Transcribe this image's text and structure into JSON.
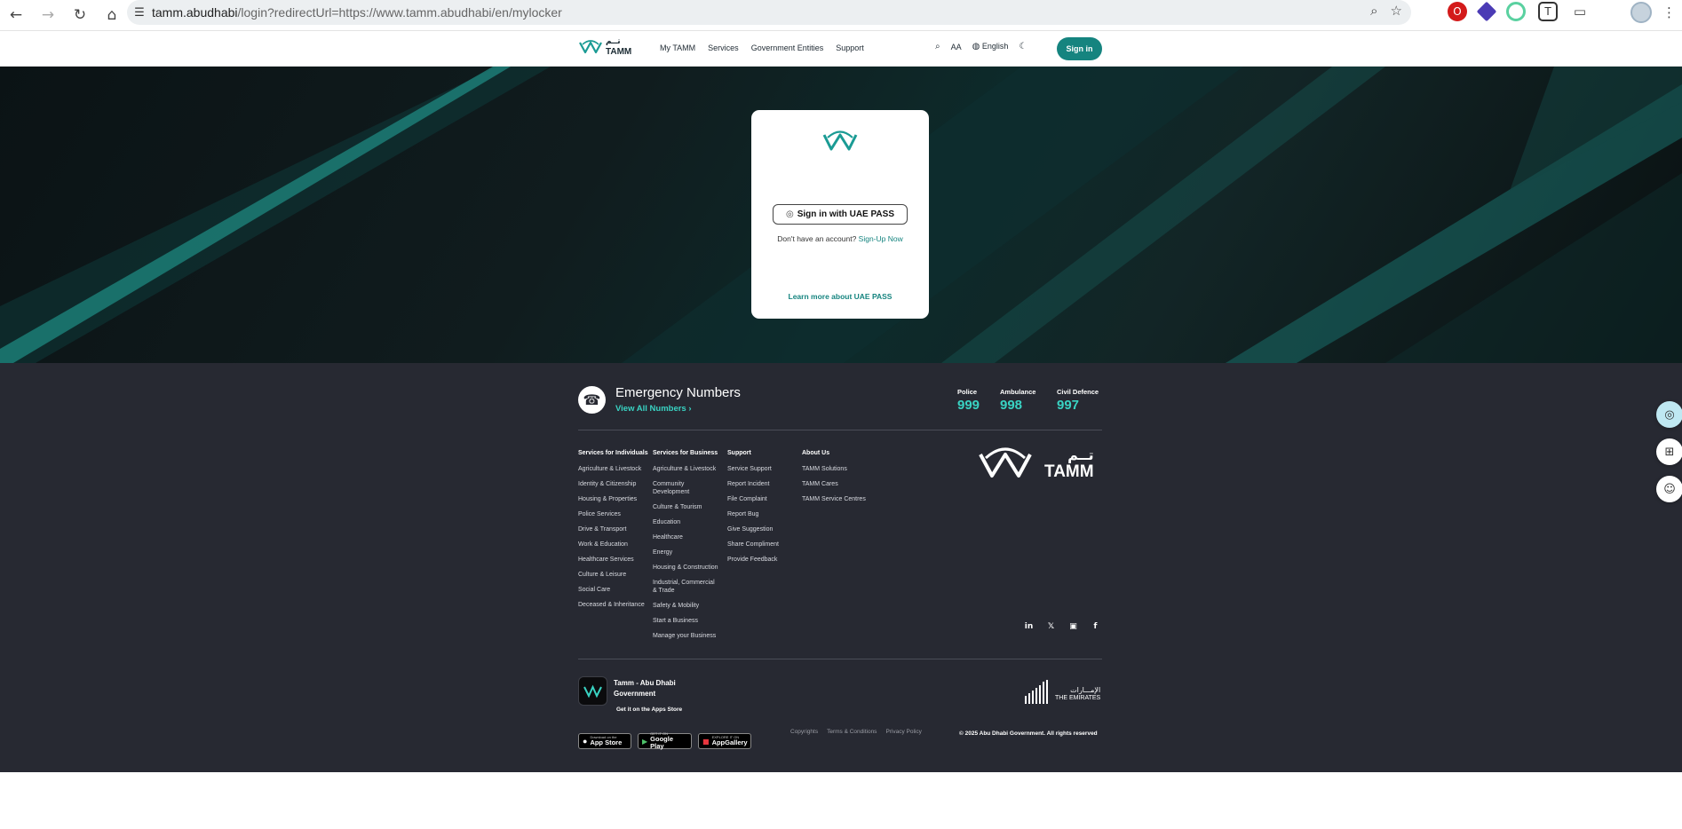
{
  "browser": {
    "back_icon": "←",
    "forward_icon": "→",
    "reload_icon": "↻",
    "home_icon": "⌂",
    "tune_icon": "☰",
    "url_host": "tamm.abudhabi",
    "url_path": "/login?redirectUrl=https://www.tamm.abudhabi/en/mylocker",
    "zoom_icon": "⌕",
    "star_icon": "☆",
    "menu_icon": "⋮"
  },
  "header": {
    "logo_arabic": "تــم",
    "logo_word": "TAMM",
    "nav": [
      "My TAMM",
      "Services",
      "Government Entities",
      "Support"
    ],
    "search_icon": "⌕",
    "text_size_label": "AA",
    "globe_icon": "◍",
    "language": "English",
    "theme_icon": "☾",
    "sign_in": "Sign in"
  },
  "login_card": {
    "uae_pass_button": "Sign in with UAE PASS",
    "fingerprint_icon": "◎",
    "no_account": "Don't have an account?",
    "sign_up": "Sign-Up Now",
    "learn_more": "Learn more about UAE PASS"
  },
  "footer": {
    "phone_icon": "☎",
    "emergency_title": "Emergency Numbers",
    "view_all": "View All Numbers  ›",
    "numbers": [
      {
        "label": "Police",
        "value": "999"
      },
      {
        "label": "Ambulance",
        "value": "998"
      },
      {
        "label": "Civil Defence",
        "value": "997"
      }
    ],
    "columns": [
      {
        "heading": "Services for Individuals",
        "items": [
          "Agriculture & Livestock",
          "Identity & Citizenship",
          "Housing & Properties",
          "Police Services",
          "Drive & Transport",
          "Work & Education",
          "Healthcare Services",
          "Culture & Leisure",
          "Social Care",
          "Deceased & Inheritance"
        ]
      },
      {
        "heading": "Services for Business",
        "items": [
          "Agriculture & Livestock",
          "Community Development",
          "Culture & Tourism",
          "Education",
          "Healthcare",
          "Energy",
          "Housing & Construction",
          "Industrial, Commercial & Trade",
          "Safety & Mobility",
          "Start a Business",
          "Manage your Business"
        ]
      },
      {
        "heading": "Support",
        "items": [
          "Service Support",
          "Report Incident",
          "File Complaint",
          "Report Bug",
          "Give Suggestion",
          "Share Compliment",
          "Provide Feedback"
        ]
      },
      {
        "heading": "About Us",
        "items": [
          "TAMM Solutions",
          "TAMM Cares",
          "TAMM Service Centres"
        ]
      }
    ],
    "big_logo_arabic": "تــم",
    "big_logo_word": "TAMM",
    "social": [
      "in",
      "𝕏",
      "▣",
      "f"
    ],
    "app_name": "Tamm - Abu Dhabi Government",
    "get_it": "Get it on the Apps Store",
    "badges": [
      {
        "small": "Download on the",
        "big": "App Store",
        "icon": ""
      },
      {
        "small": "GET IT ON",
        "big": "Google Play",
        "icon": "▶"
      },
      {
        "small": "EXPLORE IT ON",
        "big": "AppGallery",
        "icon": "■"
      }
    ],
    "emirates_arabic": "الإمـــارات",
    "emirates_english": "THE EMIRATES",
    "legal": [
      "Copyrights",
      "Terms & Conditions",
      "Privacy Policy"
    ],
    "copyright": "© 2025 Abu Dhabi Government. All rights reserved"
  },
  "floating": [
    "◎",
    "⊞",
    "☺"
  ],
  "colors": {
    "accent": "#15847f",
    "teal_text": "#39d3c3",
    "footer_bg": "#272932"
  }
}
